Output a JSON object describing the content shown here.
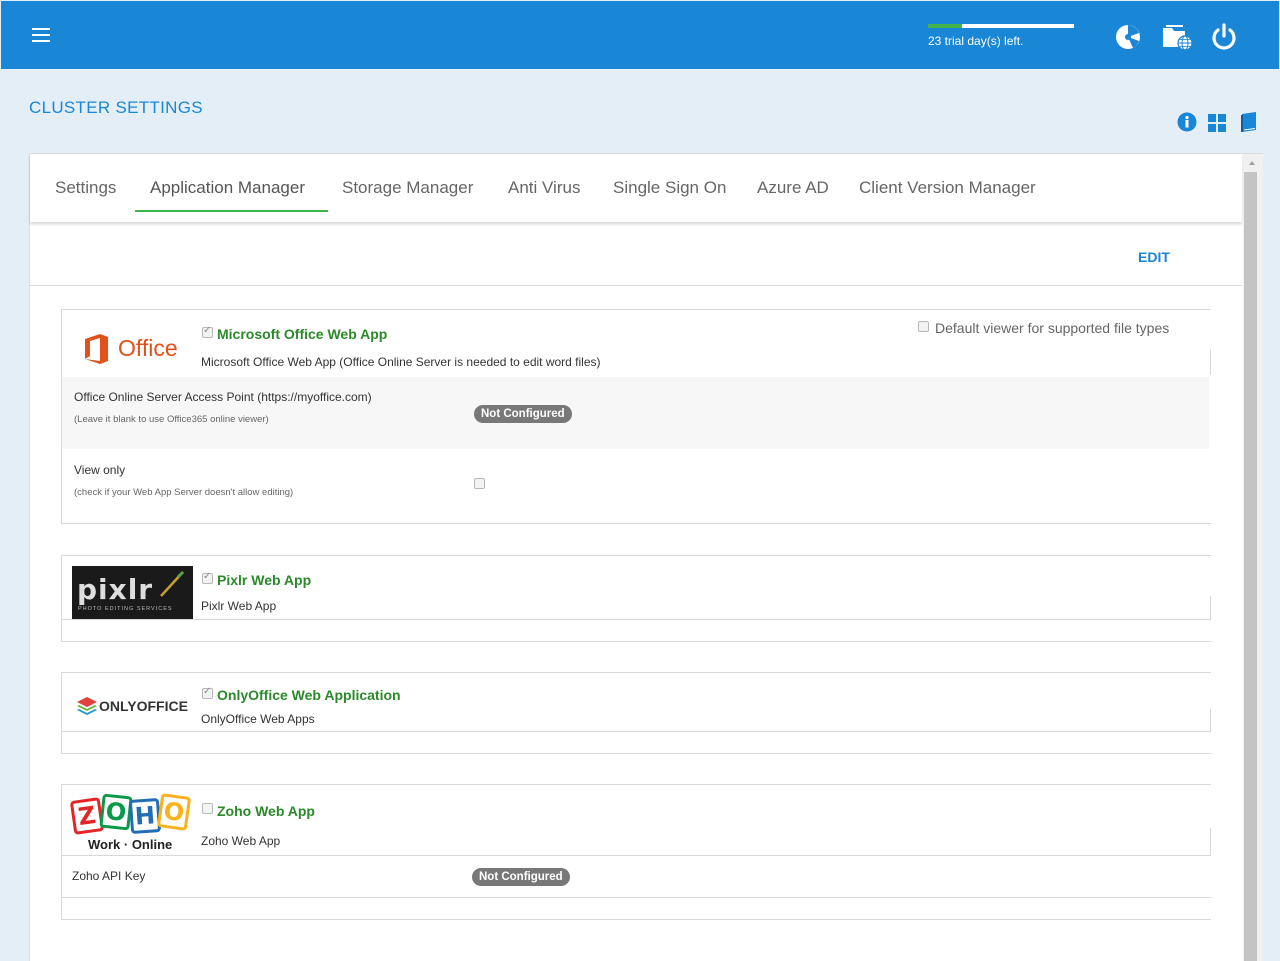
{
  "topbar": {
    "trial_text": "23 trial day(s) left.",
    "trial_progress": 0.23,
    "accent_color": "#1a86d6",
    "icons": [
      "menu-icon",
      "dashboard-icon",
      "folder-globe-icon",
      "power-icon"
    ]
  },
  "header": {
    "title": "CLUSTER SETTINGS",
    "icons": [
      "info-icon",
      "grid-icon",
      "book-icon"
    ]
  },
  "tabs": [
    {
      "label": "Settings"
    },
    {
      "label": "Application Manager",
      "active": true
    },
    {
      "label": "Storage Manager"
    },
    {
      "label": "Anti Virus"
    },
    {
      "label": "Single Sign On"
    },
    {
      "label": "Azure AD"
    },
    {
      "label": "Client Version Manager"
    }
  ],
  "edit_label": "EDIT",
  "apps": {
    "office": {
      "logo_text": "Office",
      "title": "Microsoft Office Web App",
      "enabled": true,
      "desc": "Microsoft Office Web App (Office Online Server is needed to edit word files)",
      "default_viewer_label": "Default viewer for supported file types",
      "default_viewer_checked": false,
      "access_point_label": "Office Online Server Access Point (https://myoffice.com)",
      "access_point_hint": "(Leave it blank to use Office365 online viewer)",
      "access_point_value": "Not Configured",
      "view_only_label": "View only",
      "view_only_hint": "(check if your Web App Server doesn't allow editing)",
      "view_only_checked": false
    },
    "pixlr": {
      "logo_text": "pixlr",
      "logo_sub": "PHOTO EDITING SERVICES",
      "title": "Pixlr Web App",
      "enabled": true,
      "desc": "Pixlr Web App"
    },
    "onlyoffice": {
      "logo_text": "ONLYOFFICE",
      "title": "OnlyOffice Web Application",
      "enabled": true,
      "desc": "OnlyOffice Web Apps"
    },
    "zoho": {
      "logo_letters": [
        "Z",
        "O",
        "H",
        "O"
      ],
      "logo_sub": "Work · Online",
      "title": "Zoho Web App",
      "enabled": false,
      "desc": "Zoho Web App",
      "api_key_label": "Zoho API Key",
      "api_key_value": "Not Configured"
    }
  }
}
